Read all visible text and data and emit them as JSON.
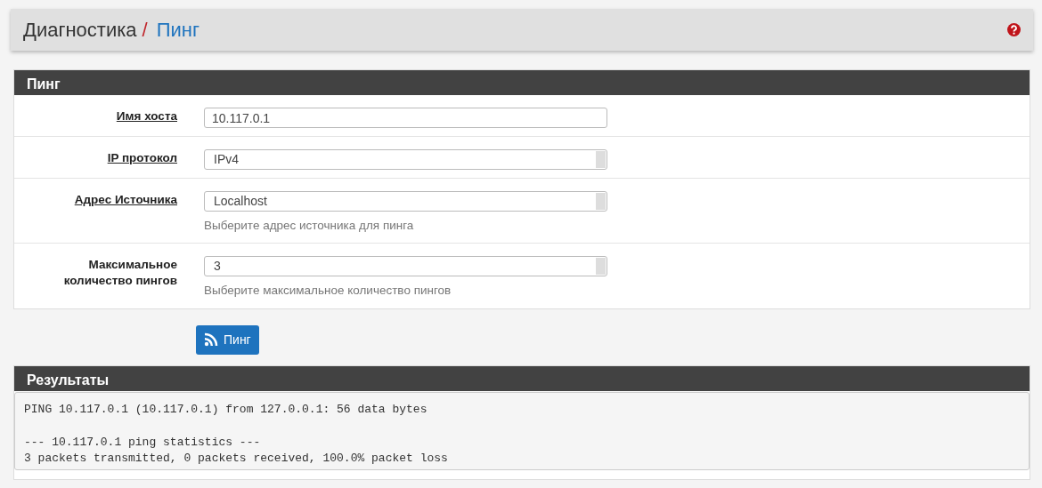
{
  "breadcrumb": {
    "section": "Диагностика",
    "separator": "/",
    "page": "Пинг"
  },
  "form_panel": {
    "title": "Пинг",
    "fields": [
      {
        "kind": "input",
        "label": "Имя хоста",
        "label_linked": true,
        "value": "10.117.0.1"
      },
      {
        "kind": "select",
        "label": "IP протокол",
        "label_linked": true,
        "value": "IPv4"
      },
      {
        "kind": "select",
        "label": "Адрес Источника",
        "label_linked": true,
        "value": "Localhost",
        "help": "Выберите адрес источника для пинга"
      },
      {
        "kind": "select",
        "label": "Максимальное количество пингов",
        "label_linked": false,
        "value": "3",
        "help": "Выберите максимальное количество пингов"
      }
    ]
  },
  "ping_button": {
    "label": "Пинг"
  },
  "results_panel": {
    "title": "Результаты",
    "blocks": [
      [
        "PING 10.117.0.1 (10.117.0.1) from 127.0.0.1: 56 data bytes"
      ],
      [
        "--- 10.117.0.1 ping statistics ---",
        "3 packets transmitted, 0 packets received, 100.0% packet loss"
      ]
    ]
  }
}
